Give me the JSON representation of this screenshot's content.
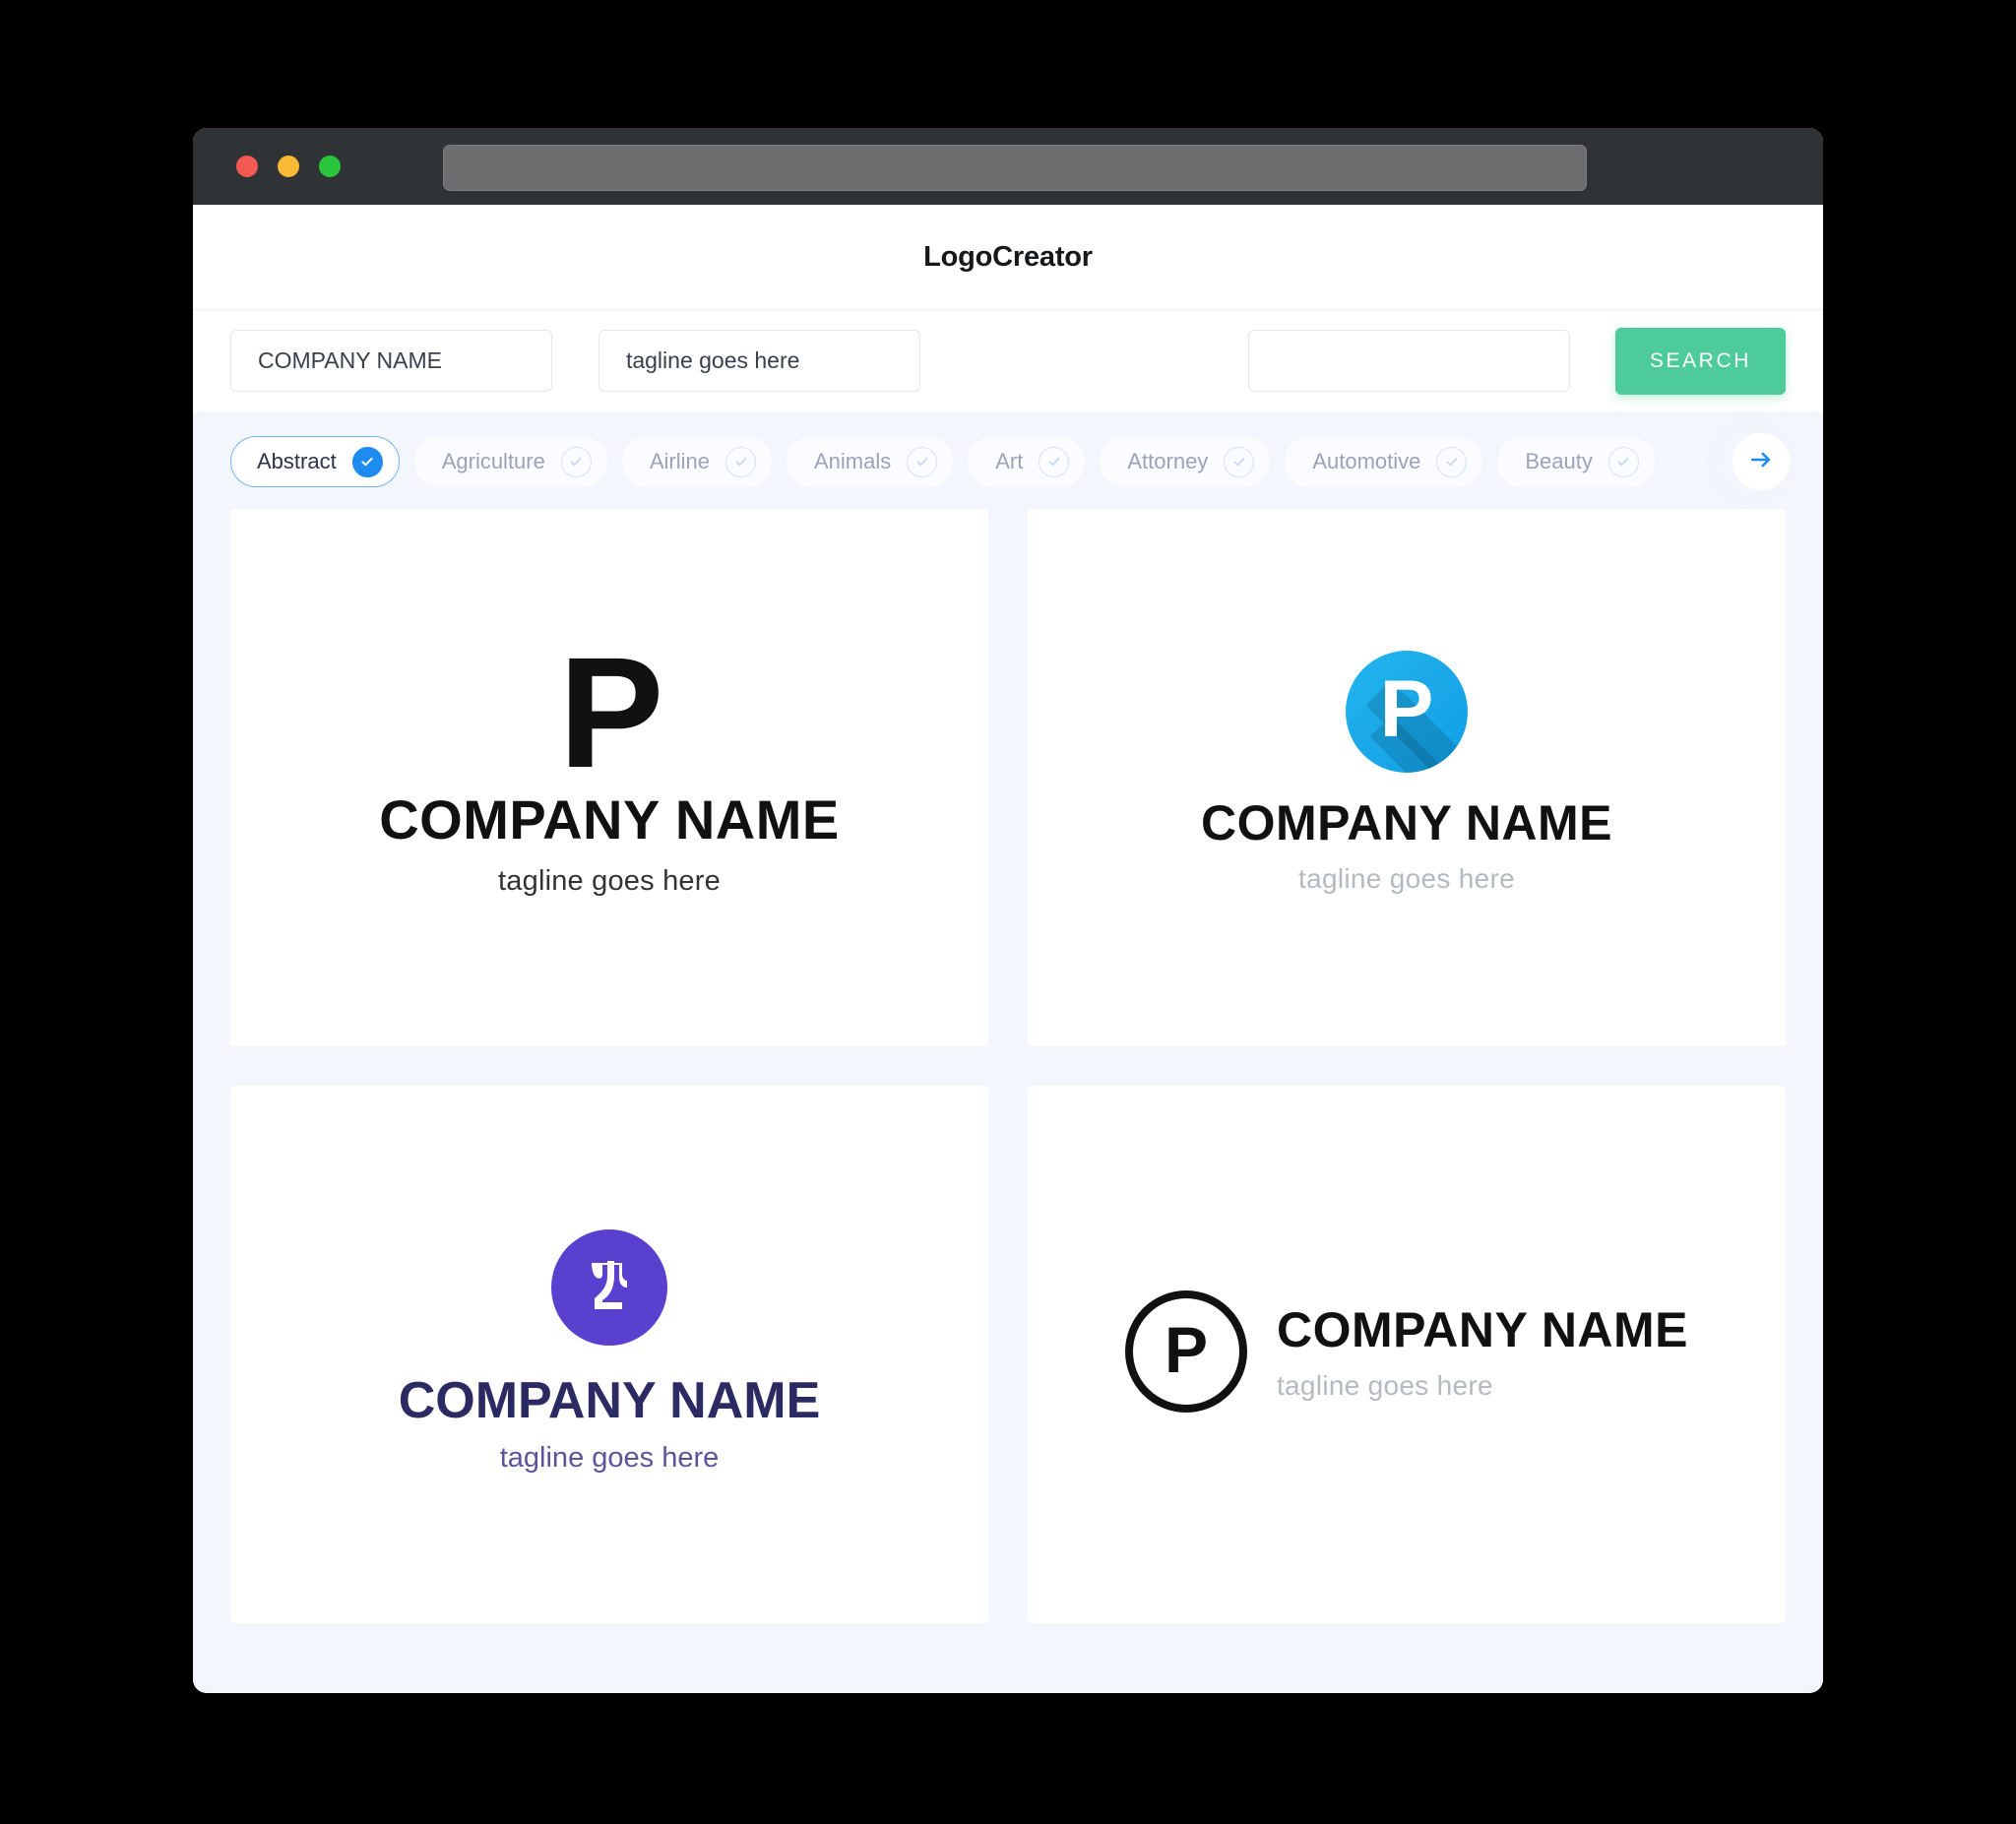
{
  "window": {
    "traffic_lights": [
      {
        "name": "close",
        "color": "#f35953"
      },
      {
        "name": "minimize",
        "color": "#f9b935"
      },
      {
        "name": "maximize",
        "color": "#29c63b"
      }
    ],
    "address_bar_value": "",
    "address_bar_placeholder": ""
  },
  "header": {
    "title": "LogoCreator"
  },
  "search": {
    "company_value": "COMPANY NAME",
    "company_placeholder": "COMPANY NAME",
    "tagline_value": "tagline goes here",
    "tagline_placeholder": "tagline goes here",
    "extra_value": "",
    "extra_placeholder": "",
    "button_label": "SEARCH",
    "button_color": "#4ecb9a"
  },
  "categories": {
    "next_icon": "arrow-right-icon",
    "accent_color": "#1e8bf0",
    "items": [
      {
        "label": "Abstract",
        "active": true
      },
      {
        "label": "Agriculture",
        "active": false
      },
      {
        "label": "Airline",
        "active": false
      },
      {
        "label": "Animals",
        "active": false
      },
      {
        "label": "Art",
        "active": false
      },
      {
        "label": "Attorney",
        "active": false
      },
      {
        "label": "Automotive",
        "active": false
      },
      {
        "label": "Beauty",
        "active": false
      }
    ]
  },
  "logos": [
    {
      "style": "black-letter-stacked",
      "mark_letter": "P",
      "mark_color": "#111111",
      "name": "COMPANY NAME",
      "name_color": "#111111",
      "tagline": "tagline goes here",
      "tagline_color": "#333333"
    },
    {
      "style": "blue-circle-longshadow",
      "mark_letter": "P",
      "mark_color": "#ffffff",
      "badge_color": "#1ba9e8",
      "name": "COMPANY NAME",
      "name_color": "#111111",
      "tagline": "tagline goes here",
      "tagline_color": "#b6b9c0"
    },
    {
      "style": "purple-circle-glyph",
      "mark_glyph": "ayin-glyph",
      "badge_color": "#5a40cf",
      "name": "COMPANY NAME",
      "name_color": "#2c2a63",
      "tagline": "tagline goes here",
      "tagline_color": "#5a559b"
    },
    {
      "style": "outline-circle-horizontal",
      "mark_letter": "P",
      "mark_color": "#111111",
      "name": "COMPANY NAME",
      "name_color": "#111111",
      "tagline": "tagline goes here",
      "tagline_color": "#b6b9c0"
    }
  ]
}
